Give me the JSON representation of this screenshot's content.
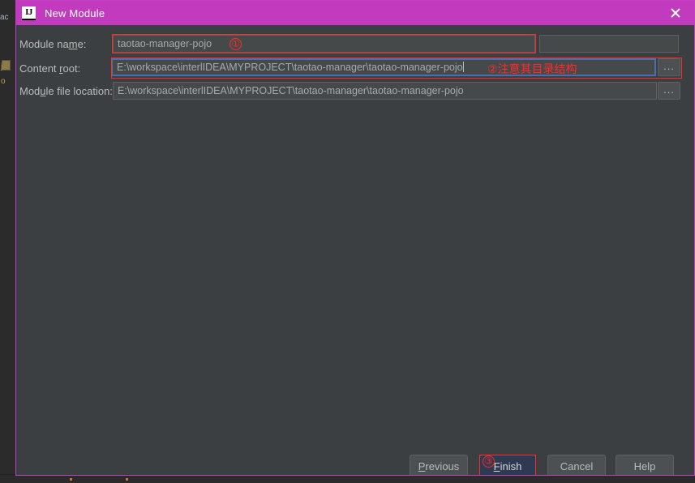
{
  "window": {
    "title": "New Module",
    "app_icon": "intellij-idea-icon",
    "close_icon": "close-icon",
    "title_bar_color": "#C23BBE",
    "body_color": "#3C3F41",
    "border_color": "#C13FC1"
  },
  "form": {
    "module_name": {
      "label_before": "Module na",
      "label_mnemonic": "m",
      "label_after": "e:",
      "value": "taotao-manager-pojo",
      "placeholder": ""
    },
    "content_root": {
      "label_before": "Content ",
      "label_mnemonic": "r",
      "label_after": "oot:",
      "value": "E:\\workspace\\interlIDEA\\MYPROJECT\\taotao-manager\\taotao-manager-pojo",
      "placeholder": "",
      "browse_label": "...",
      "focused": true
    },
    "module_file_location": {
      "label_before": "Mod",
      "label_mnemonic": "u",
      "label_after": "le file location:",
      "value": "E:\\workspace\\interlIDEA\\MYPROJECT\\taotao-manager\\taotao-manager-pojo",
      "placeholder": "",
      "browse_label": "..."
    }
  },
  "annotations": {
    "color": "#FF2A2A",
    "marker_1": "①",
    "marker_2": "②",
    "marker_3": "③",
    "note_2_text": "注意其目录结构"
  },
  "buttons": {
    "previous": {
      "before": "",
      "mnemonic": "P",
      "after": "revious"
    },
    "finish": {
      "before": "",
      "mnemonic": "F",
      "after": "inish",
      "is_default": true
    },
    "cancel": {
      "before": "Cancel",
      "mnemonic": "",
      "after": ""
    },
    "help": {
      "before": "Help",
      "mnemonic": "",
      "after": ""
    }
  },
  "background": {
    "fragment_top": "ac",
    "fragment_mid": "j",
    "fragment_bottom": "o"
  }
}
